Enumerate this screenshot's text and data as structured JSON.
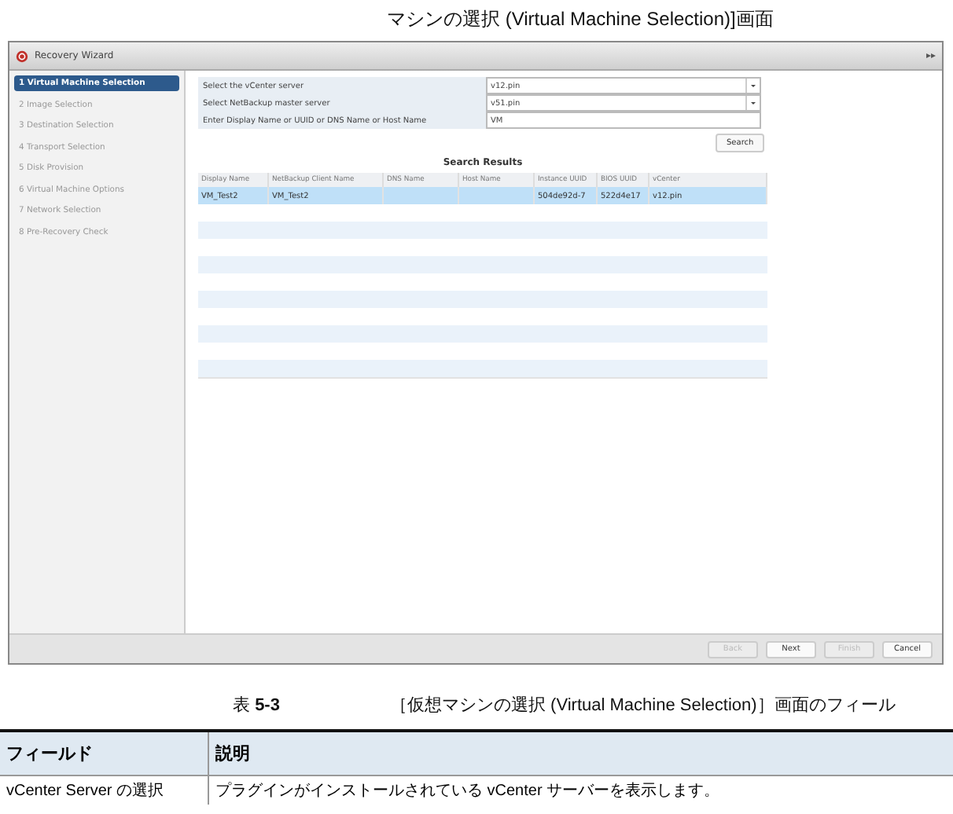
{
  "top_caption": "マシンの選択 (Virtual Machine Selection)]画面",
  "window": {
    "title": "Recovery Wizard",
    "collapse_glyph": "▸▸"
  },
  "steps": [
    {
      "label": "1  Virtual Machine Selection",
      "selected": true
    },
    {
      "label": "2  Image Selection",
      "selected": false
    },
    {
      "label": "3  Destination Selection",
      "selected": false
    },
    {
      "label": "4  Transport Selection",
      "selected": false
    },
    {
      "label": "5  Disk Provision",
      "selected": false
    },
    {
      "label": "6  Virtual Machine Options",
      "selected": false
    },
    {
      "label": "7  Network Selection",
      "selected": false
    },
    {
      "label": "8  Pre-Recovery Check",
      "selected": false
    }
  ],
  "form": [
    {
      "label": "Select the vCenter server",
      "kind": "dropdown",
      "value": "v12.pin"
    },
    {
      "label": "Select NetBackup master server",
      "kind": "dropdown",
      "value": "v51.pin"
    },
    {
      "label": "Enter Display Name or UUID or DNS Name or Host Name",
      "kind": "text",
      "value": "VM"
    }
  ],
  "search_button": "Search",
  "results": {
    "title": "Search Results",
    "columns": [
      "Display Name",
      "NetBackup Client Name",
      "DNS Name",
      "Host Name",
      "Instance UUID",
      "BIOS UUID",
      "vCenter"
    ],
    "rows": [
      {
        "selected": true,
        "cells": [
          "VM_Test2",
          "VM_Test2",
          "",
          "",
          "504de92d-7",
          "522d4e17",
          "v12.pin"
        ]
      }
    ]
  },
  "buttons": [
    {
      "label": "Back",
      "disabled": true
    },
    {
      "label": "Next",
      "disabled": false
    },
    {
      "label": "Finish",
      "disabled": true
    },
    {
      "label": "Cancel",
      "disabled": false
    }
  ],
  "table_caption": {
    "number": "表 **5-3**",
    "title": "［仮想マシンの選択 (Virtual Machine Selection)］画面のフィール"
  },
  "doc_table": {
    "columns": [
      "フィールド",
      "説明"
    ],
    "rows": [
      [
        "vCenter Server の選択",
        "プラグインがインストールされている vCenter サーバーを表示します。"
      ]
    ]
  }
}
